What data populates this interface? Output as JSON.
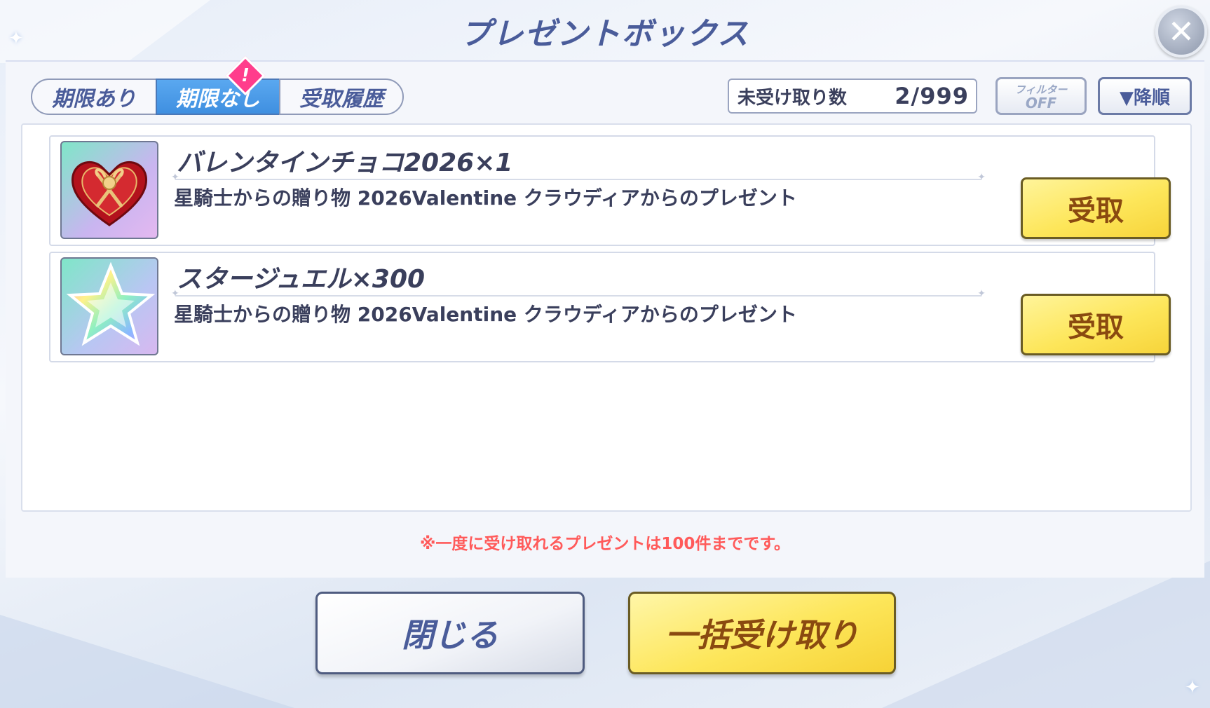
{
  "header": {
    "title": "プレゼントボックス",
    "close_icon": "close-icon"
  },
  "tabs": [
    {
      "label": "期限あり",
      "selected": false
    },
    {
      "label": "期限なし",
      "selected": true,
      "badge": "!"
    },
    {
      "label": "受取履歴",
      "selected": false
    }
  ],
  "counter": {
    "label": "未受け取り数",
    "value": "2/999"
  },
  "filter": {
    "label_top": "フィルター",
    "label_bottom": "OFF"
  },
  "sort": {
    "label": "▼降順"
  },
  "items": [
    {
      "name": "バレンタインチョコ2026×1",
      "description": "星騎士からの贈り物 2026Valentine クラウディアからのプレゼント",
      "button": "受取",
      "icon": "heart-chocolate-box-icon"
    },
    {
      "name": "スタージュエル×300",
      "description": "星騎士からの贈り物 2026Valentine クラウディアからのプレゼント",
      "button": "受取",
      "icon": "star-jewel-icon"
    }
  ],
  "notice": "※一度に受け取れるプレゼントは100件までです。",
  "footer": {
    "close_label": "閉じる",
    "bulk_label": "一括受け取り"
  },
  "colors": {
    "accent_yellow": "#fde65a",
    "tab_selected": "#4a9ae8",
    "notice_red": "#ff5a5a",
    "title": "#4a5c9a"
  }
}
